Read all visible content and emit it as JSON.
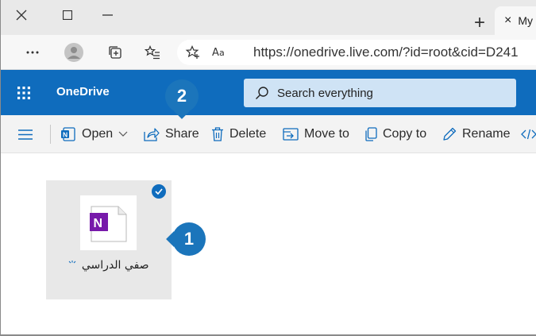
{
  "titlebar": {
    "tab_label": "My",
    "new_tab_symbol": "+",
    "tab_close_symbol": "×"
  },
  "navbar": {
    "url": "https://onedrive.live.com/?id=root&cid=D241"
  },
  "app": {
    "name": "OneDrive",
    "search_placeholder": "Search everything"
  },
  "commands": {
    "open": "Open",
    "share": "Share",
    "delete": "Delete",
    "move_to": "Move to",
    "copy_to": "Copy to",
    "rename": "Rename"
  },
  "file": {
    "name": "صفي الدراسي",
    "icon_letter": "N",
    "selected": true
  },
  "callouts": {
    "one": "1",
    "two": "2"
  },
  "colors": {
    "header": "#0f6cbd",
    "search_bg": "#cfe3f5",
    "callout": "#1b75bb",
    "onenote": "#7719aa"
  }
}
